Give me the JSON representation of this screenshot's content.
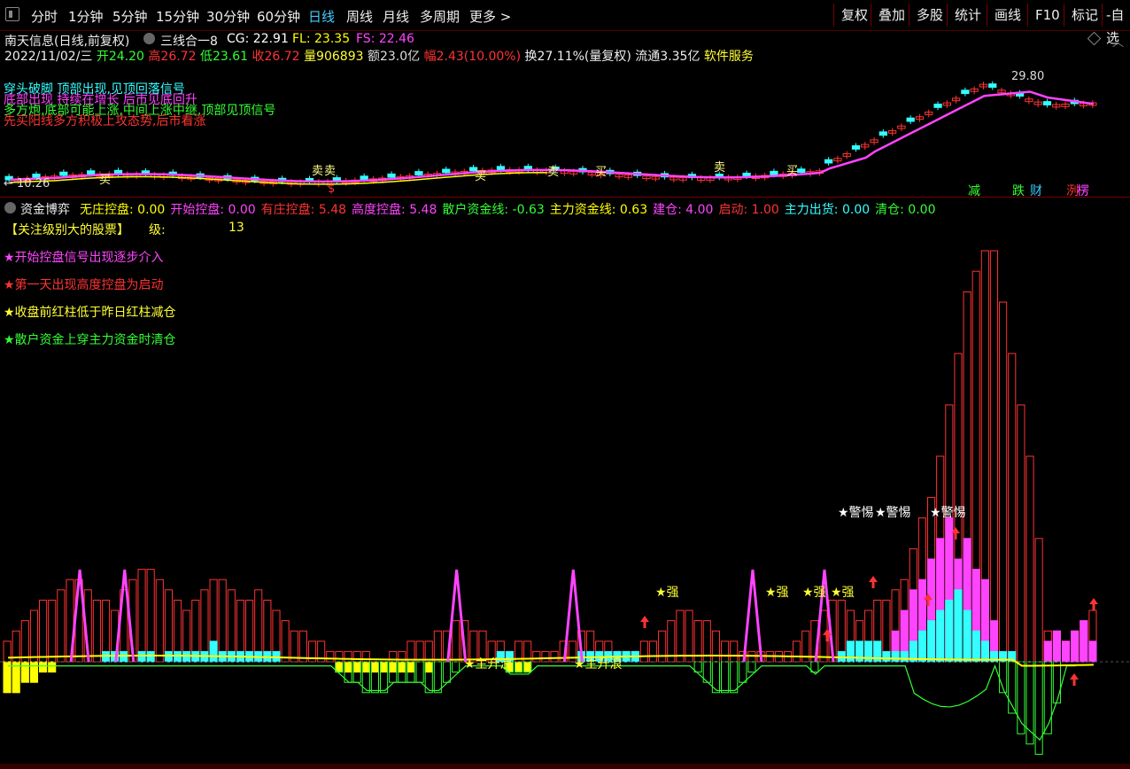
{
  "toolbar": {
    "periods": [
      "分时",
      "1分钟",
      "5分钟",
      "15分钟",
      "30分钟",
      "60分钟",
      "日线",
      "周线",
      "月线",
      "多周期",
      "更多 >"
    ],
    "active_period": "日线",
    "right_buttons": [
      "复权",
      "叠加",
      "多股",
      "统计",
      "画线",
      "F10",
      "标记",
      "-自选"
    ]
  },
  "header": {
    "stock": "南天信息(日线,前复权)",
    "indicator_name": "三线合一8",
    "cg_label": "CG: 22.91",
    "fl_label": "FL: 23.35",
    "fs_label": "FS: 22.46"
  },
  "quote": {
    "date": "2022/11/02/三",
    "open": "开24.20",
    "high": "高26.72",
    "low": "低23.61",
    "close": "收26.72",
    "volume": "量906893",
    "amount": "额23.0亿",
    "change": "幅2.43(10.00%)",
    "turnover": "换27.11%(量复权)",
    "float": "流通3.35亿",
    "sector": "软件服务"
  },
  "notes": {
    "line1": "穿头破脚 顶部出现,见顶回落信号",
    "line1b": "底部出现 持续在增长 后市见底回升",
    "line2": "多方炮,底部可能上涨,中间上涨中继,顶部见顶信号",
    "line3": "先买阳线多方积极上攻态势,后市看涨"
  },
  "price_chart": {
    "high_label": "29.80",
    "low_label": "← 10.26",
    "signals": [
      "减",
      "跌",
      "财",
      "洌",
      "楞"
    ],
    "marks": [
      "买",
      "卖",
      "卖",
      "买",
      "卖",
      "买",
      "卖",
      "买",
      "卖",
      "买",
      "卖"
    ],
    "s_mark": "$"
  },
  "indicator": {
    "title": "资金博弈",
    "fields": [
      {
        "label": "无庄控盘: 0.00",
        "color": "#ffff00"
      },
      {
        "label": "开始控盘: 0.00",
        "color": "#ff44ff"
      },
      {
        "label": "有庄控盘: 5.48",
        "color": "#ff3333"
      },
      {
        "label": "高度控盘: 5.48",
        "color": "#ff44ff"
      },
      {
        "label": "散户资金线: -0.63",
        "color": "#33ff33"
      },
      {
        "label": "主力资金线: 0.63",
        "color": "#ffff00"
      },
      {
        "label": "建仓: 4.00",
        "color": "#ff44ff"
      },
      {
        "label": "启动: 1.00",
        "color": "#ff3333"
      },
      {
        "label": "主力出货: 0.00",
        "color": "#33ffff"
      },
      {
        "label": "清仓: 0.00",
        "color": "#33ff33"
      }
    ],
    "focus_label": "【关注级别大的股票】",
    "level_label": "级:",
    "level_value": "13",
    "tips": [
      {
        "text": "★开始控盘信号出现逐步介入",
        "color": "#ff44ff"
      },
      {
        "text": "★第一天出现高度控盘为启动",
        "color": "#ff3333"
      },
      {
        "text": "★收盘前红柱低于昨日红柱减仓",
        "color": "#ffff33"
      },
      {
        "text": "★散户资金上穿主力资金时清仓",
        "color": "#33ff33"
      }
    ],
    "annotations": {
      "warn": "★警惕",
      "strong": "★强",
      "main_up": "★主升浪"
    }
  },
  "colors": {
    "up": "#ff3333",
    "down": "#33ffff",
    "ma": "#ff44ff",
    "yellow": "#ffff00",
    "green": "#33ff33",
    "watermark": "cfchi.com"
  },
  "chart_data": {
    "type": "bar",
    "title": "资金博弈",
    "ref_line_y": 0,
    "red_bars": [
      2,
      3,
      4,
      5,
      6,
      6,
      7,
      8,
      8,
      7,
      6,
      6,
      5,
      7,
      8,
      9,
      9,
      8,
      7,
      6,
      5,
      6,
      7,
      8,
      8,
      7,
      6,
      6,
      7,
      6,
      5,
      4,
      3,
      3,
      2,
      2,
      1,
      1,
      1,
      1,
      1,
      0,
      0,
      1,
      1,
      2,
      2,
      2,
      3,
      3,
      4,
      4,
      3,
      3,
      2,
      2,
      1,
      2,
      2,
      1,
      1,
      1,
      2,
      2,
      3,
      3,
      2,
      2,
      1,
      1,
      1,
      2,
      2,
      3,
      4,
      5,
      5,
      4,
      4,
      3,
      2,
      2,
      1,
      1,
      1,
      1,
      1,
      1,
      2,
      3,
      4,
      5,
      6,
      6,
      5,
      4,
      5,
      6,
      6,
      7,
      8,
      11,
      14,
      16,
      20,
      25,
      30,
      36,
      38,
      40,
      40,
      35,
      30,
      25,
      20,
      12,
      3,
      3,
      2,
      3,
      4,
      5
    ],
    "magenta_bars": [
      0,
      0,
      0,
      0,
      0,
      0,
      0,
      0,
      0,
      0,
      0,
      0,
      0,
      0,
      0,
      0,
      0,
      0,
      0,
      0,
      0,
      0,
      0,
      0,
      0,
      0,
      0,
      0,
      0,
      0,
      0,
      0,
      0,
      0,
      0,
      0,
      0,
      0,
      0,
      0,
      0,
      0,
      0,
      0,
      0,
      0,
      0,
      0,
      0,
      0,
      0,
      0,
      0,
      0,
      0,
      0,
      0,
      0,
      0,
      0,
      0,
      0,
      0,
      0,
      0,
      0,
      0,
      0,
      0,
      0,
      0,
      0,
      0,
      0,
      0,
      0,
      0,
      0,
      0,
      0,
      0,
      0,
      0,
      0,
      0,
      0,
      0,
      0,
      0,
      0,
      0,
      0,
      0,
      0,
      0,
      0,
      0,
      0,
      0,
      3,
      5,
      7,
      8,
      10,
      12,
      14,
      10,
      12,
      9,
      8,
      4,
      0,
      0,
      0,
      0,
      0,
      2,
      3,
      2,
      3,
      4,
      2
    ],
    "cyan_bars": [
      0,
      0,
      0,
      0,
      0,
      0,
      0,
      0,
      0,
      0,
      0,
      1,
      1,
      1,
      0,
      1,
      1,
      0,
      1,
      1,
      1,
      1,
      1,
      2,
      1,
      1,
      1,
      1,
      1,
      1,
      1,
      0,
      0,
      0,
      0,
      0,
      0,
      0,
      0,
      0,
      0,
      0,
      0,
      0,
      0,
      0,
      0,
      0,
      0,
      0,
      0,
      0,
      0,
      0,
      0,
      1,
      1,
      0,
      0,
      0,
      0,
      0,
      0,
      0,
      1,
      1,
      1,
      1,
      1,
      1,
      1,
      0,
      0,
      0,
      0,
      0,
      0,
      0,
      0,
      0,
      0,
      0,
      0,
      0,
      0,
      0,
      0,
      0,
      0,
      0,
      0,
      0,
      0,
      1,
      2,
      2,
      2,
      2,
      1,
      1,
      1,
      2,
      3,
      4,
      5,
      6,
      7,
      5,
      3,
      2,
      1,
      1,
      1,
      0,
      0,
      0,
      0,
      0,
      0,
      0,
      0,
      0
    ],
    "yellow_neg_bars": [
      -3,
      -3,
      -2,
      -2,
      -1,
      -1,
      0,
      0,
      0,
      0,
      0,
      0,
      0,
      0,
      0,
      0,
      0,
      0,
      0,
      0,
      0,
      0,
      0,
      0,
      0,
      0,
      0,
      0,
      0,
      0,
      0,
      0,
      0,
      0,
      0,
      0,
      0,
      -1,
      -1,
      -1,
      -1,
      -1,
      -1,
      -1,
      -1,
      -1,
      0,
      -1,
      0,
      0,
      0,
      0,
      0,
      0,
      0,
      0,
      -1,
      -1,
      -1,
      0,
      0,
      0,
      0,
      0,
      0,
      0,
      0,
      0,
      0,
      0,
      0,
      0,
      0,
      0,
      0,
      0,
      0,
      0,
      0,
      0,
      0,
      0,
      0,
      0,
      0,
      0,
      0,
      0,
      0,
      0,
      0,
      0,
      0,
      0,
      0,
      0,
      0,
      0,
      0,
      0,
      0,
      0,
      0,
      0,
      0,
      0,
      0,
      0,
      0,
      0,
      0,
      0,
      0,
      0,
      0,
      0,
      0,
      0,
      0,
      0,
      0,
      0
    ],
    "green_neg_bars": [
      0,
      0,
      0,
      0,
      0,
      0,
      0,
      0,
      0,
      0,
      0,
      0,
      0,
      0,
      0,
      0,
      0,
      0,
      0,
      0,
      0,
      0,
      0,
      0,
      0,
      0,
      0,
      0,
      0,
      0,
      0,
      0,
      0,
      0,
      0,
      0,
      0,
      -1,
      -2,
      -2,
      -3,
      -3,
      -3,
      -2,
      -2,
      -2,
      -2,
      -3,
      -3,
      -2,
      -1,
      0,
      0,
      0,
      0,
      0,
      -1,
      -1,
      -1,
      0,
      0,
      0,
      0,
      0,
      0,
      0,
      0,
      0,
      0,
      0,
      0,
      0,
      0,
      0,
      0,
      0,
      0,
      -1,
      -2,
      -3,
      -3,
      -3,
      -2,
      -1,
      0,
      0,
      0,
      0,
      0,
      0,
      -1,
      0,
      0,
      0,
      0,
      0,
      0,
      0,
      0,
      0,
      0,
      0,
      0,
      0,
      0,
      0,
      0,
      0,
      0,
      0,
      0,
      -3,
      -5,
      -7,
      -8,
      -9,
      -7,
      -4,
      0,
      0
    ],
    "spikes_index": [
      8,
      13,
      50,
      63,
      83,
      91
    ]
  }
}
